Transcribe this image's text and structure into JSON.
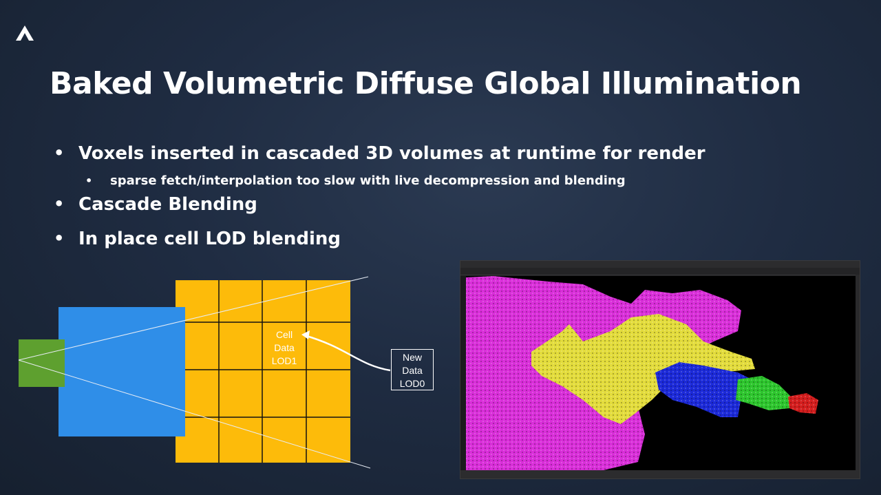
{
  "slide": {
    "title": "Baked Volumetric Diffuse Global Illumination",
    "bullets": [
      {
        "text": "Voxels inserted in cascaded 3D volumes at runtime for render"
      },
      {
        "text": "sparse fetch/interpolation too slow with live decompression and blending",
        "level": 2
      },
      {
        "text": "Cascade Blending"
      },
      {
        "text": "In place cell LOD blending"
      }
    ]
  },
  "diagram": {
    "cell_label": [
      "Cell",
      "Data",
      "LOD1"
    ],
    "new_label": [
      "New",
      "Data",
      "LOD0"
    ],
    "colors": {
      "small": "#5ea02f",
      "mid": "#2f8ee8",
      "grid": "#fdbb0a",
      "lines": "#ffffff"
    }
  },
  "screenshot": {
    "colors": {
      "magenta": "#d92fd9",
      "yellow": "#e3dc3c",
      "blue": "#1c2ad8",
      "green": "#2ec62e",
      "red": "#d41e1e"
    }
  }
}
